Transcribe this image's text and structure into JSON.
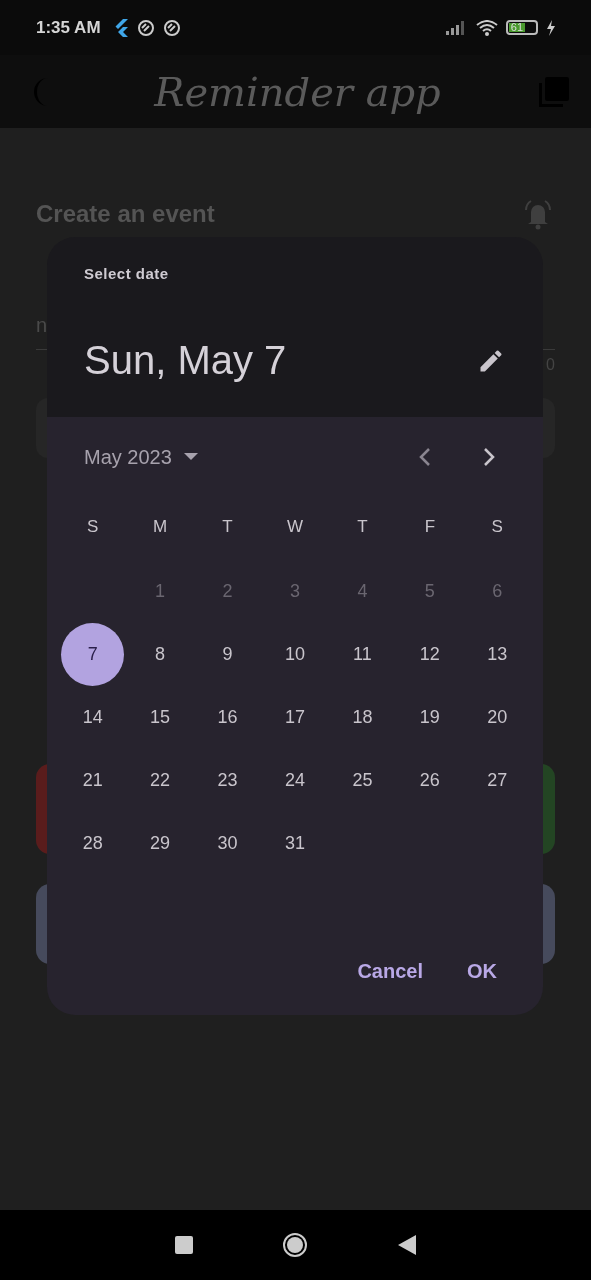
{
  "status_bar": {
    "time": "1:35 AM",
    "battery": "61"
  },
  "app_bar": {
    "title": "Reminder app"
  },
  "background": {
    "heading": "Create an event",
    "field_text": "n",
    "field_counter": "0"
  },
  "date_picker": {
    "label": "Select date",
    "selected_date": "Sun, May 7",
    "month": "May 2023",
    "weekdays": [
      "S",
      "M",
      "T",
      "W",
      "T",
      "F",
      "S"
    ],
    "weeks": [
      [
        {
          "day": "1",
          "selected": false,
          "disabled": true
        },
        {
          "day": "2",
          "selected": false,
          "disabled": true
        },
        {
          "day": "3",
          "selected": false,
          "disabled": true
        },
        {
          "day": "4",
          "selected": false,
          "disabled": true
        },
        {
          "day": "5",
          "selected": false,
          "disabled": true
        },
        {
          "day": "6",
          "selected": false,
          "disabled": true
        }
      ],
      [
        {
          "day": "7",
          "selected": true,
          "disabled": false
        },
        {
          "day": "8",
          "selected": false,
          "disabled": false
        },
        {
          "day": "9",
          "selected": false,
          "disabled": false
        },
        {
          "day": "10",
          "selected": false,
          "disabled": false
        },
        {
          "day": "11",
          "selected": false,
          "disabled": false
        },
        {
          "day": "12",
          "selected": false,
          "disabled": false
        },
        {
          "day": "13",
          "selected": false,
          "disabled": false
        }
      ],
      [
        {
          "day": "14",
          "selected": false,
          "disabled": false
        },
        {
          "day": "15",
          "selected": false,
          "disabled": false
        },
        {
          "day": "16",
          "selected": false,
          "disabled": false
        },
        {
          "day": "17",
          "selected": false,
          "disabled": false
        },
        {
          "day": "18",
          "selected": false,
          "disabled": false
        },
        {
          "day": "19",
          "selected": false,
          "disabled": false
        },
        {
          "day": "20",
          "selected": false,
          "disabled": false
        }
      ],
      [
        {
          "day": "21",
          "selected": false,
          "disabled": false
        },
        {
          "day": "22",
          "selected": false,
          "disabled": false
        },
        {
          "day": "23",
          "selected": false,
          "disabled": false
        },
        {
          "day": "24",
          "selected": false,
          "disabled": false
        },
        {
          "day": "25",
          "selected": false,
          "disabled": false
        },
        {
          "day": "26",
          "selected": false,
          "disabled": false
        },
        {
          "day": "27",
          "selected": false,
          "disabled": false
        }
      ],
      [
        {
          "day": "28",
          "selected": false,
          "disabled": false
        },
        {
          "day": "29",
          "selected": false,
          "disabled": false
        },
        {
          "day": "30",
          "selected": false,
          "disabled": false
        },
        {
          "day": "31",
          "selected": false,
          "disabled": false
        }
      ]
    ],
    "buttons": [
      "Cancel",
      "OK"
    ]
  }
}
